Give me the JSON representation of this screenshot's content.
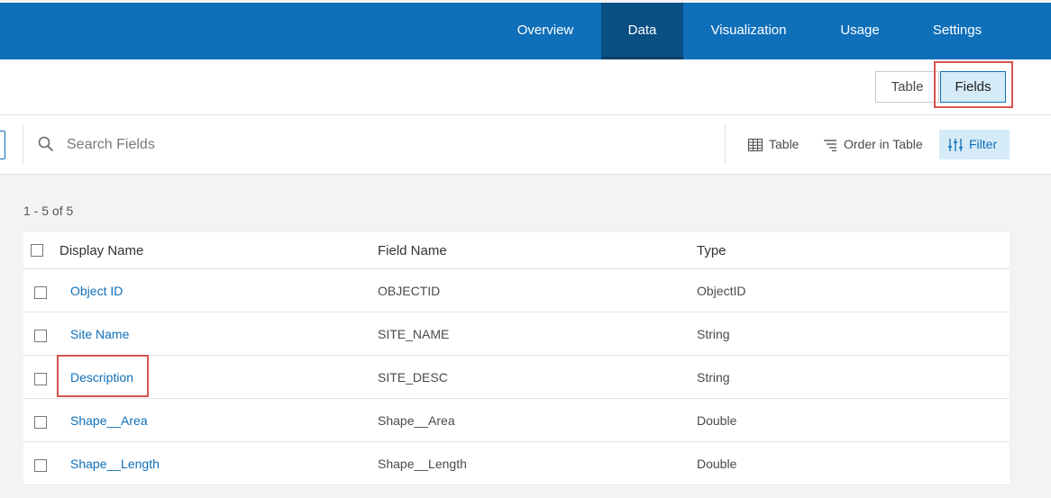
{
  "nav": {
    "tabs": [
      {
        "label": "Overview",
        "active": false
      },
      {
        "label": "Data",
        "active": true
      },
      {
        "label": "Visualization",
        "active": false
      },
      {
        "label": "Usage",
        "active": false
      },
      {
        "label": "Settings",
        "active": false
      }
    ]
  },
  "view_switch": {
    "table_label": "Table",
    "fields_label": "Fields",
    "selected": "Fields"
  },
  "toolbar": {
    "search_placeholder": "Search Fields",
    "table_button": "Table",
    "order_button": "Order in Table",
    "filter_button": "Filter"
  },
  "results": {
    "count_text": "1 - 5 of 5"
  },
  "columns": {
    "display_name": "Display Name",
    "field_name": "Field Name",
    "type": "Type"
  },
  "rows": [
    {
      "display_name": "Object ID",
      "field_name": "OBJECTID",
      "type": "ObjectID"
    },
    {
      "display_name": "Site Name",
      "field_name": "SITE_NAME",
      "type": "String"
    },
    {
      "display_name": "Description",
      "field_name": "SITE_DESC",
      "type": "String"
    },
    {
      "display_name": "Shape__Area",
      "field_name": "Shape__Area",
      "type": "Double"
    },
    {
      "display_name": "Shape__Length",
      "field_name": "Shape__Length",
      "type": "Double"
    }
  ],
  "colors": {
    "nav_bg": "#0f6fb9",
    "nav_active": "#0a4f84",
    "link": "#0f6fb9",
    "highlight": "#d9534f",
    "selected_bg": "#d5ebf8"
  },
  "icons": {
    "search": "search-icon",
    "table": "table-icon",
    "order": "sort-lines-icon",
    "filter": "sliders-icon"
  }
}
